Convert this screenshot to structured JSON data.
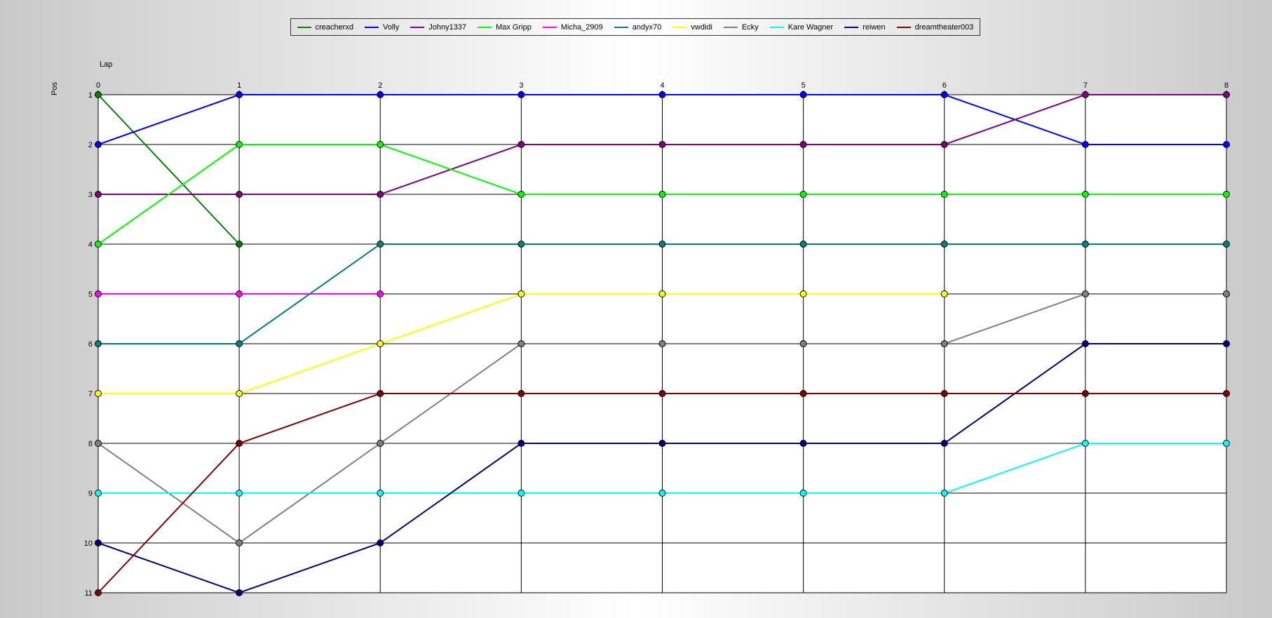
{
  "chart_data": {
    "type": "line",
    "xlabel": "Lap",
    "ylabel": "Pos",
    "x": [
      0,
      1,
      2,
      3,
      4,
      5,
      6,
      7,
      8
    ],
    "y_ticks": [
      1,
      2,
      3,
      4,
      5,
      6,
      7,
      8,
      9,
      10,
      11
    ],
    "ylim": [
      1,
      11
    ],
    "y_inverted": true,
    "grid": true,
    "legend_position": "top-center",
    "series": [
      {
        "name": "creacherxd",
        "color": "#008000",
        "values": [
          1,
          4
        ]
      },
      {
        "name": "Volly",
        "color": "#0000ff",
        "values": [
          2,
          1,
          1,
          1,
          1,
          1,
          1,
          2,
          2
        ]
      },
      {
        "name": "Johny1337",
        "color": "#800080",
        "values": [
          3,
          3,
          3,
          2,
          2,
          2,
          2,
          1,
          1
        ]
      },
      {
        "name": "Max Gripp",
        "color": "#00ff00",
        "values": [
          4,
          2,
          2,
          3,
          3,
          3,
          3,
          3,
          3
        ]
      },
      {
        "name": "Micha_2909",
        "color": "#ff00ff",
        "values": [
          5,
          5,
          5
        ]
      },
      {
        "name": "andyx70",
        "color": "#008080",
        "values": [
          6,
          6,
          4,
          4,
          4,
          4,
          4,
          4,
          4
        ]
      },
      {
        "name": "vwdidi",
        "color": "#ffff00",
        "values": [
          7,
          7,
          6,
          5,
          5,
          5,
          5
        ]
      },
      {
        "name": "Ecky",
        "color": "#808080",
        "values": [
          8,
          10,
          8,
          6,
          6,
          6,
          6,
          5,
          5
        ]
      },
      {
        "name": "Kare Wagner",
        "color": "#00ffff",
        "values": [
          9,
          9,
          9,
          9,
          9,
          9,
          9,
          8,
          8
        ]
      },
      {
        "name": "reiwen",
        "color": "#000080",
        "values": [
          10,
          11,
          10,
          8,
          8,
          8,
          8,
          6,
          6
        ]
      },
      {
        "name": "dreamtheater003",
        "color": "#800000",
        "values": [
          11,
          8,
          7,
          7,
          7,
          7,
          7,
          7,
          7
        ]
      }
    ]
  }
}
